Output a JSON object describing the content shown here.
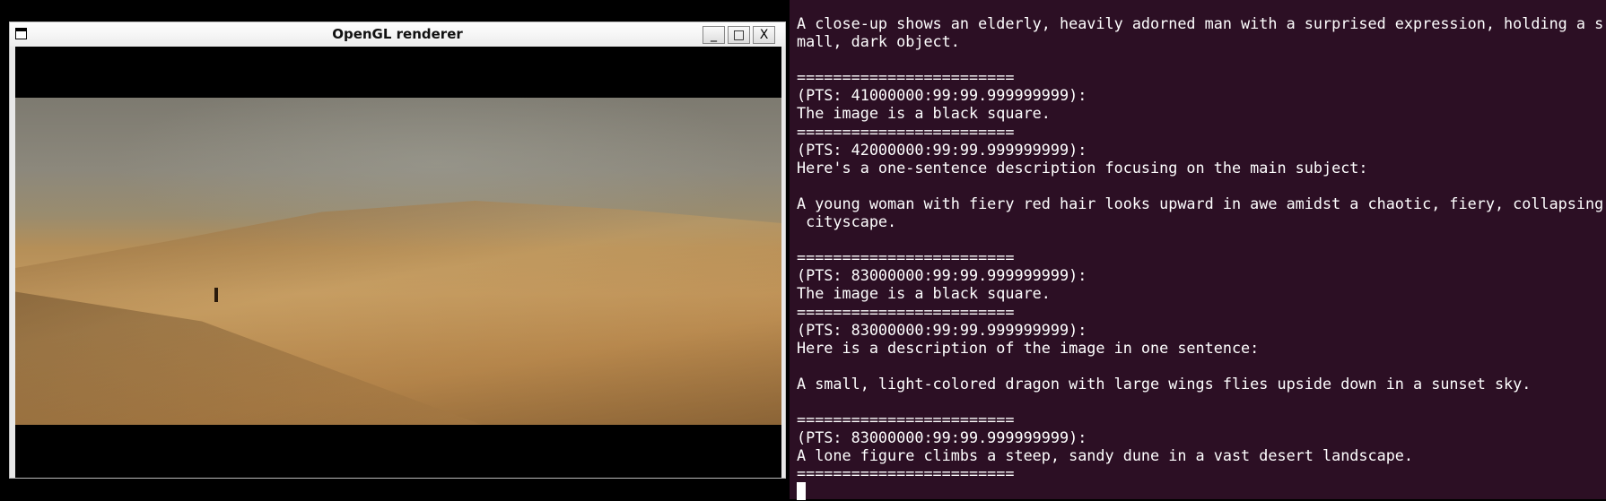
{
  "window": {
    "title": "OpenGL renderer",
    "buttons": {
      "minimize": "_",
      "maximize": "□",
      "close": "X"
    }
  },
  "terminal": {
    "lines": [
      "A close-up shows an elderly, heavily adorned man with a surprised expression, holding a s",
      "mall, dark object.",
      "",
      "========================",
      "(PTS: 41000000:99:99.999999999):",
      "The image is a black square.",
      "========================",
      "(PTS: 42000000:99:99.999999999):",
      "Here's a one-sentence description focusing on the main subject:",
      "",
      "A young woman with fiery red hair looks upward in awe amidst a chaotic, fiery, collapsing",
      " cityscape.",
      "",
      "========================",
      "(PTS: 83000000:99:99.999999999):",
      "The image is a black square.",
      "========================",
      "(PTS: 83000000:99:99.999999999):",
      "Here is a description of the image in one sentence:",
      "",
      "A small, light-colored dragon with large wings flies upside down in a sunset sky.",
      "",
      "========================",
      "(PTS: 83000000:99:99.999999999):",
      "A lone figure climbs a steep, sandy dune in a vast desert landscape.",
      "========================"
    ],
    "background": "#2c0f24"
  }
}
